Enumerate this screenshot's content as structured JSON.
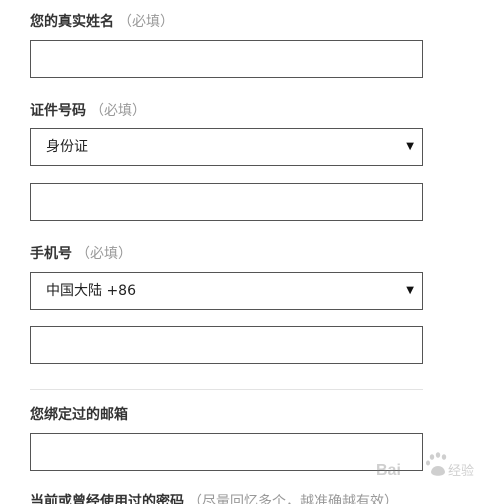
{
  "fields": {
    "name": {
      "label": "您的真实姓名",
      "required": "（必填）",
      "value": ""
    },
    "id_number": {
      "label": "证件号码",
      "required": "（必填）",
      "id_type_selected": "身份证",
      "value": ""
    },
    "phone": {
      "label": "手机号",
      "required": "（必填）",
      "country_selected": "中国大陆 +86",
      "value": ""
    },
    "bound_email": {
      "label": "您绑定过的邮箱",
      "value": ""
    },
    "used_passwords": {
      "label": "当前或曾经使用过的密码",
      "hint": "（尽量回忆多个，越准确越有效）"
    }
  },
  "icons": {
    "dropdown": "caret-down-icon",
    "watermark": "baidu-jingyan-logo"
  },
  "watermark_text": "Bai百经验"
}
